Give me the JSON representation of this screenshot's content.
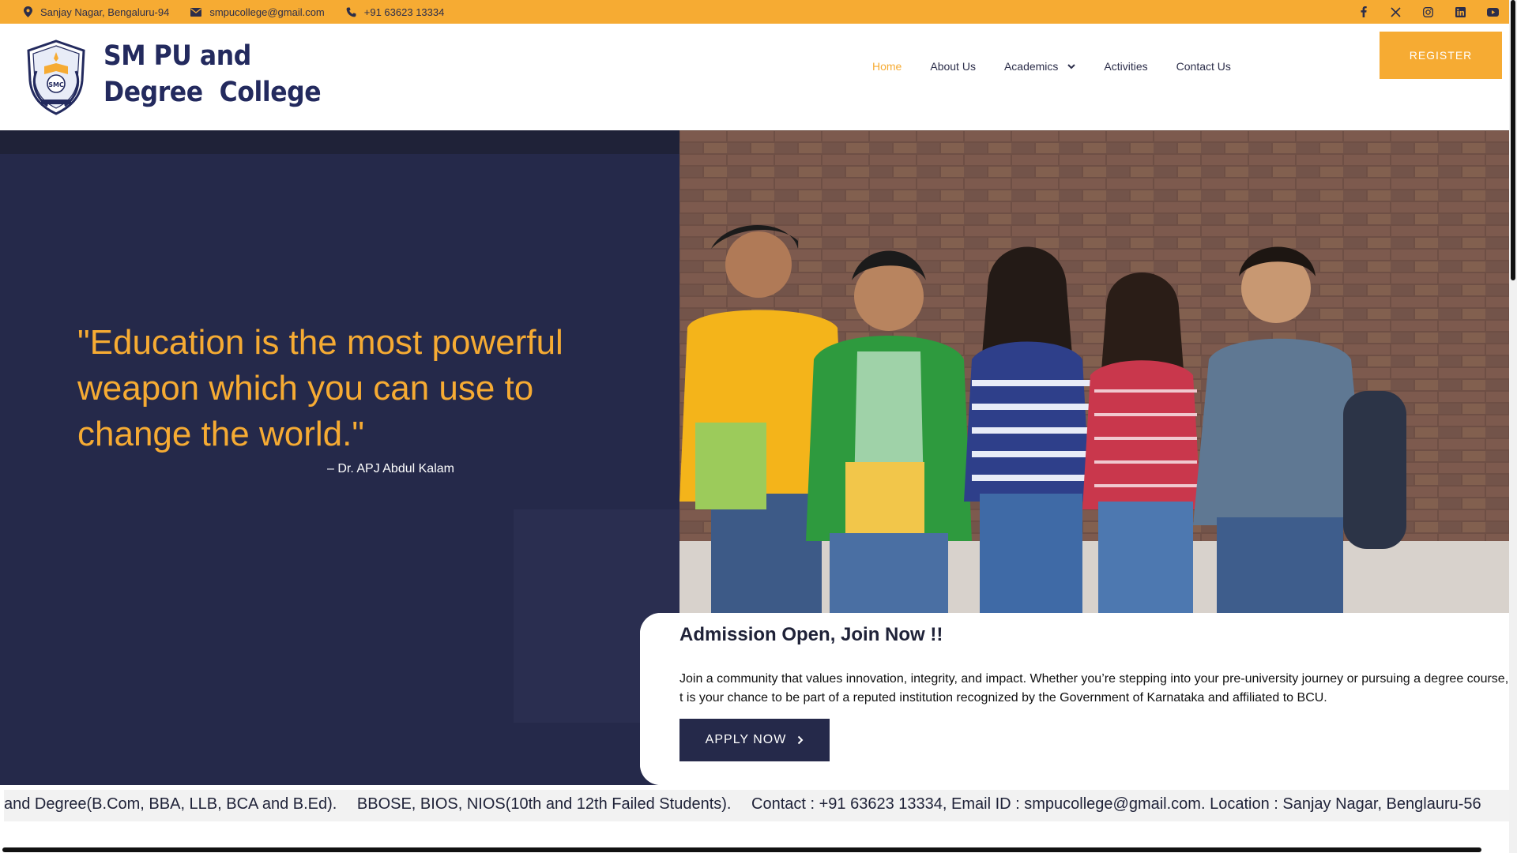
{
  "topbar": {
    "address": "Sanjay Nagar, Bengaluru-94",
    "email": "smpucollege@gmail.com",
    "phone": "+91 63623 13334",
    "socials": [
      "facebook-icon",
      "x-icon",
      "instagram-icon",
      "linkedin-icon",
      "youtube-icon"
    ]
  },
  "brand": {
    "line1": "SM PU and",
    "line2": "Degree  College",
    "emblem_text": "SMC"
  },
  "nav": {
    "items": [
      {
        "label": "Home",
        "active": true
      },
      {
        "label": "About Us",
        "active": false
      },
      {
        "label": "Academics",
        "active": false,
        "has_dropdown": true
      },
      {
        "label": "Activities",
        "active": false
      },
      {
        "label": "Contact Us",
        "active": false
      }
    ]
  },
  "register_label": "REGISTER",
  "hero": {
    "quote": "\"Education is the most powerful weapon which you can use to change the world.\"",
    "author": "– Dr. APJ Abdul Kalam"
  },
  "admission": {
    "title": "Admission Open, Join Now !!",
    "text": "Join a community that values innovation, integrity, and impact. Whether you’re stepping into your pre-university journey or pursuing a degree course, t is your chance to be part of a reputed institution recognized by the Government of Karnataka and affiliated to BCU.",
    "button": "APPLY NOW"
  },
  "ticker": [
    "rce) and Degree(B.Com, BBA, LLB, BCA and B.Ed).",
    "BBOSE, BIOS, NIOS(10th and 12th Failed Students).",
    "Contact : +91 63623 13334, Email ID : smpucollege@gmail.com. Location : Sanjay Nagar, Benglauru-56"
  ],
  "colors": {
    "accent": "#f6ab33",
    "navy": "#25294a",
    "brand_text": "#232a5e"
  }
}
